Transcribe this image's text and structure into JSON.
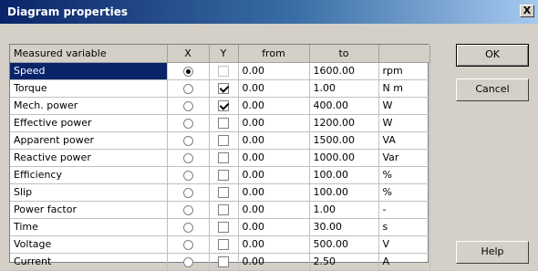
{
  "window": {
    "title": "Diagram properties",
    "close_label": "X"
  },
  "table": {
    "headers": {
      "name": "Measured variable",
      "x": "X",
      "y": "Y",
      "from": "from",
      "to": "to",
      "unit": ""
    },
    "rows": [
      {
        "name": "Speed",
        "x": true,
        "y": false,
        "y_disabled": true,
        "from": "0.00",
        "to": "1600.00",
        "unit": "rpm"
      },
      {
        "name": "Torque",
        "x": false,
        "y": true,
        "y_disabled": false,
        "from": "0.00",
        "to": "1.00",
        "unit": "N m"
      },
      {
        "name": "Mech. power",
        "x": false,
        "y": true,
        "y_disabled": false,
        "from": "0.00",
        "to": "400.00",
        "unit": "W"
      },
      {
        "name": "Effective power",
        "x": false,
        "y": false,
        "y_disabled": false,
        "from": "0.00",
        "to": "1200.00",
        "unit": "W"
      },
      {
        "name": "Apparent power",
        "x": false,
        "y": false,
        "y_disabled": false,
        "from": "0.00",
        "to": "1500.00",
        "unit": "VA"
      },
      {
        "name": "Reactive power",
        "x": false,
        "y": false,
        "y_disabled": false,
        "from": "0.00",
        "to": "1000.00",
        "unit": "Var"
      },
      {
        "name": "Efficiency",
        "x": false,
        "y": false,
        "y_disabled": false,
        "from": "0.00",
        "to": "100.00",
        "unit": "%"
      },
      {
        "name": "Slip",
        "x": false,
        "y": false,
        "y_disabled": false,
        "from": "0.00",
        "to": "100.00",
        "unit": "%"
      },
      {
        "name": "Power factor",
        "x": false,
        "y": false,
        "y_disabled": false,
        "from": "0.00",
        "to": "1.00",
        "unit": "-"
      },
      {
        "name": "Time",
        "x": false,
        "y": false,
        "y_disabled": false,
        "from": "0.00",
        "to": "30.00",
        "unit": "s"
      },
      {
        "name": "Voltage",
        "x": false,
        "y": false,
        "y_disabled": false,
        "from": "0.00",
        "to": "500.00",
        "unit": "V"
      },
      {
        "name": "Current",
        "x": false,
        "y": false,
        "y_disabled": false,
        "from": "0.00",
        "to": "2.50",
        "unit": "A"
      }
    ]
  },
  "buttons": {
    "ok": "OK",
    "cancel": "Cancel",
    "help": "Help"
  },
  "colors": {
    "selection": "#0a246a",
    "title_bar": "#0a246a",
    "face": "#d4d0c8"
  }
}
